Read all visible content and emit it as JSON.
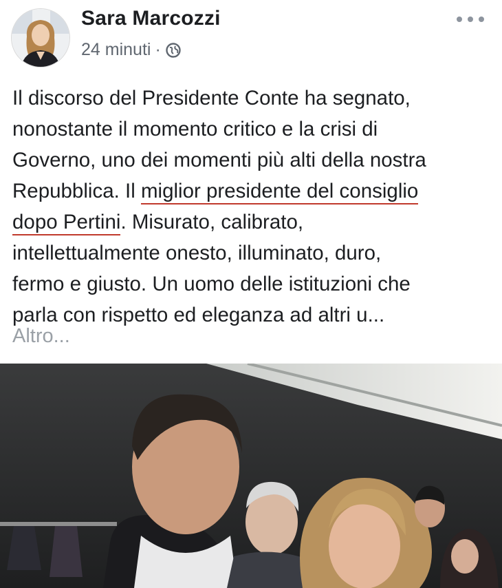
{
  "post": {
    "author": "Sara Marcozzi",
    "timestamp": "24 minuti",
    "separator": "·",
    "privacy_icon": "globe-icon",
    "more_icon": "more-options-icon",
    "text_lines": [
      "Il discorso del Presidente Conte ha segnato,",
      "nonostante il momento critico e la crisi di",
      "Governo, uno dei momenti più alti della nostra",
      "Repubblica. Il ",
      "miglior presidente del consiglio",
      "dopo Pertini",
      ". Misurato, calibrato,",
      "intellettualmente onesto, illuminato, duro,",
      "fermo e giusto. Un uomo delle istituzioni che",
      "parla con rispetto ed eleganza ad altri u..."
    ],
    "see_more": "Altro...",
    "underline_color": "#c0392b"
  }
}
